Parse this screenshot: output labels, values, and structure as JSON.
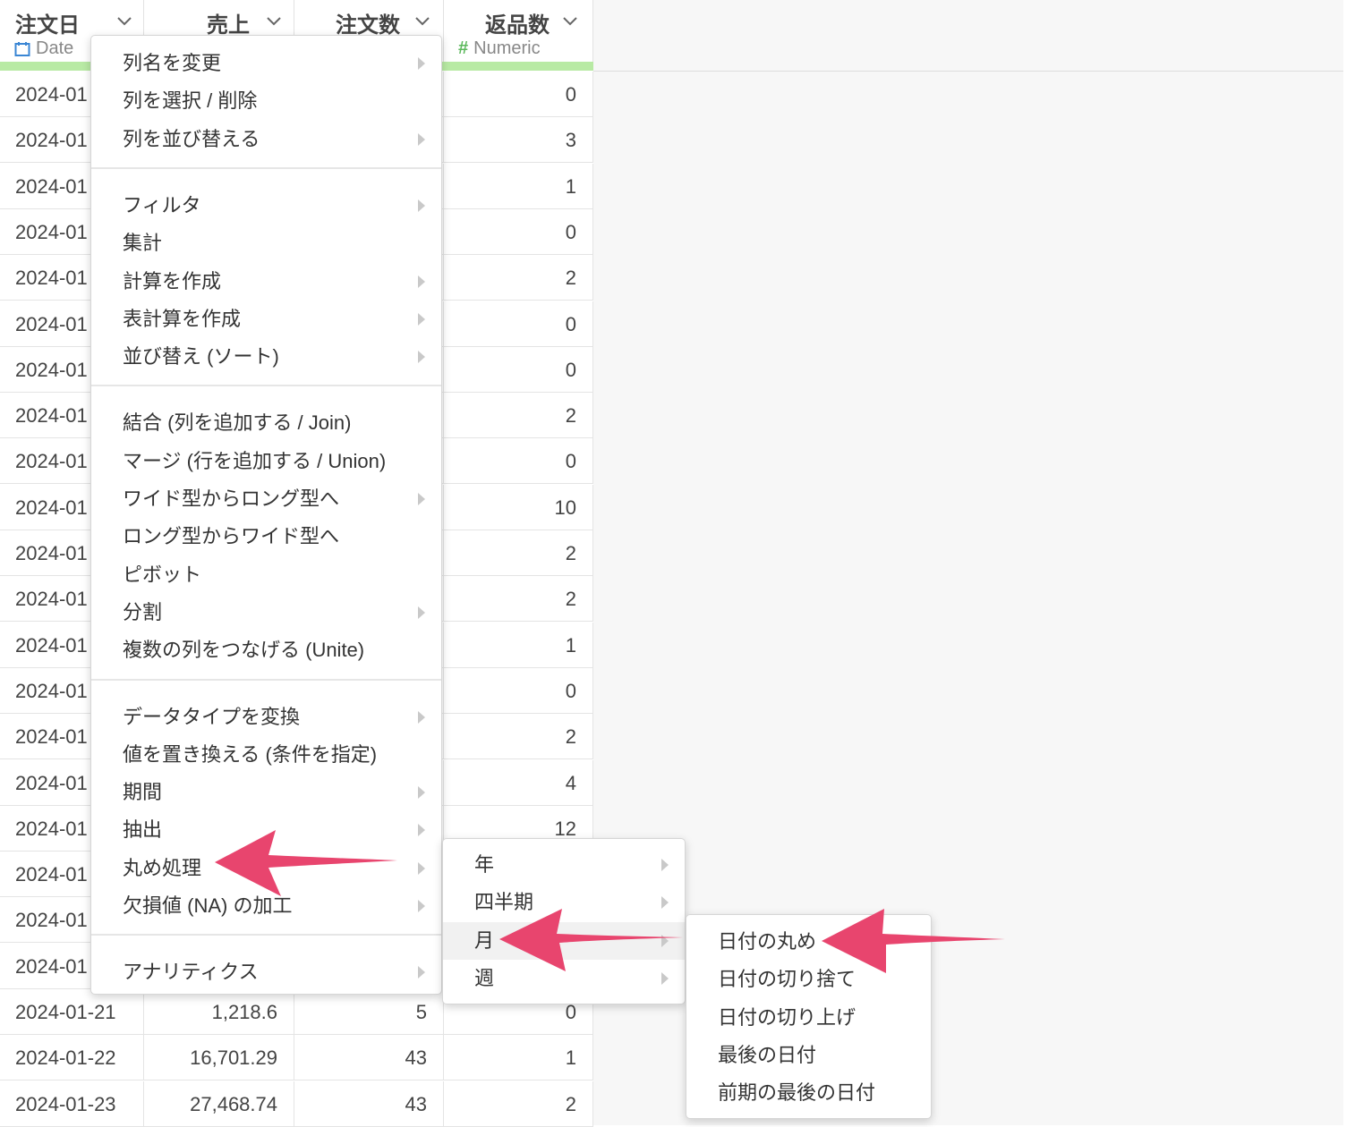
{
  "columns": [
    {
      "name": "注文日",
      "type_label": "Date",
      "type_icon": "calendar-icon"
    },
    {
      "name": "売上",
      "type_label": "",
      "type_icon": ""
    },
    {
      "name": "注文数",
      "type_label": "",
      "type_icon": ""
    },
    {
      "name": "返品数",
      "type_label": "Numeric",
      "type_icon": "hash-icon"
    }
  ],
  "rows": [
    {
      "date": "2024-01",
      "sales": "",
      "orders": "",
      "returns": "0"
    },
    {
      "date": "2024-01",
      "sales": "",
      "orders": "",
      "returns": "3"
    },
    {
      "date": "2024-01",
      "sales": "",
      "orders": "",
      "returns": "1"
    },
    {
      "date": "2024-01",
      "sales": "",
      "orders": "",
      "returns": "0"
    },
    {
      "date": "2024-01",
      "sales": "",
      "orders": "",
      "returns": "2"
    },
    {
      "date": "2024-01",
      "sales": "",
      "orders": "",
      "returns": "0"
    },
    {
      "date": "2024-01",
      "sales": "",
      "orders": "",
      "returns": "0"
    },
    {
      "date": "2024-01",
      "sales": "",
      "orders": "",
      "returns": "2"
    },
    {
      "date": "2024-01",
      "sales": "",
      "orders": "",
      "returns": "0"
    },
    {
      "date": "2024-01",
      "sales": "",
      "orders": "",
      "returns": "10"
    },
    {
      "date": "2024-01",
      "sales": "",
      "orders": "",
      "returns": "2"
    },
    {
      "date": "2024-01",
      "sales": "",
      "orders": "",
      "returns": "2"
    },
    {
      "date": "2024-01",
      "sales": "",
      "orders": "",
      "returns": "1"
    },
    {
      "date": "2024-01",
      "sales": "",
      "orders": "",
      "returns": "0"
    },
    {
      "date": "2024-01",
      "sales": "",
      "orders": "",
      "returns": "2"
    },
    {
      "date": "2024-01",
      "sales": "",
      "orders": "",
      "returns": "4"
    },
    {
      "date": "2024-01",
      "sales": "",
      "orders": "",
      "returns": "12"
    },
    {
      "date": "2024-01",
      "sales": "",
      "orders": "",
      "returns": ""
    },
    {
      "date": "2024-01",
      "sales": "",
      "orders": "",
      "returns": ""
    },
    {
      "date": "2024-01",
      "sales": "",
      "orders": "",
      "returns": ""
    },
    {
      "date": "2024-01-21",
      "sales": "1,218.6",
      "orders": "5",
      "returns": "0"
    },
    {
      "date": "2024-01-22",
      "sales": "16,701.29",
      "orders": "43",
      "returns": "1"
    },
    {
      "date": "2024-01-23",
      "sales": "27,468.74",
      "orders": "43",
      "returns": "2"
    }
  ],
  "context_menu": {
    "groups": [
      [
        {
          "label": "列名を変更",
          "submenu": true
        },
        {
          "label": "列を選択 / 削除",
          "submenu": false
        },
        {
          "label": "列を並び替える",
          "submenu": true
        }
      ],
      [
        {
          "label": "フィルタ",
          "submenu": true
        },
        {
          "label": "集計",
          "submenu": false
        },
        {
          "label": "計算を作成",
          "submenu": true
        },
        {
          "label": "表計算を作成",
          "submenu": true
        },
        {
          "label": "並び替え (ソート)",
          "submenu": true
        }
      ],
      [
        {
          "label": "結合 (列を追加する / Join)",
          "submenu": false
        },
        {
          "label": "マージ (行を追加する / Union)",
          "submenu": false
        },
        {
          "label": "ワイド型からロング型へ",
          "submenu": true
        },
        {
          "label": "ロング型からワイド型へ",
          "submenu": false
        },
        {
          "label": "ピボット",
          "submenu": false
        },
        {
          "label": "分割",
          "submenu": true
        },
        {
          "label": "複数の列をつなげる (Unite)",
          "submenu": false
        }
      ],
      [
        {
          "label": "データタイプを変換",
          "submenu": true
        },
        {
          "label": "値を置き換える (条件を指定)",
          "submenu": false
        },
        {
          "label": "期間",
          "submenu": true
        },
        {
          "label": "抽出",
          "submenu": true
        },
        {
          "label": "丸め処理",
          "submenu": true
        },
        {
          "label": "欠損値 (NA) の加工",
          "submenu": true
        }
      ],
      [
        {
          "label": "アナリティクス",
          "submenu": true
        }
      ]
    ]
  },
  "rounding_submenu": [
    {
      "label": "年",
      "submenu": true
    },
    {
      "label": "四半期",
      "submenu": true
    },
    {
      "label": "月",
      "submenu": true,
      "highlighted": true
    },
    {
      "label": "週",
      "submenu": true
    }
  ],
  "month_submenu": [
    {
      "label": "日付の丸め"
    },
    {
      "label": "日付の切り捨て"
    },
    {
      "label": "日付の切り上げ"
    },
    {
      "label": "最後の日付"
    },
    {
      "label": "前期の最後の日付"
    }
  ],
  "colors": {
    "accent_arrow": "#e8456e",
    "type_bar": "#b8eaa4",
    "date_icon": "#3a86d4",
    "numeric_icon": "#5cb85c"
  }
}
